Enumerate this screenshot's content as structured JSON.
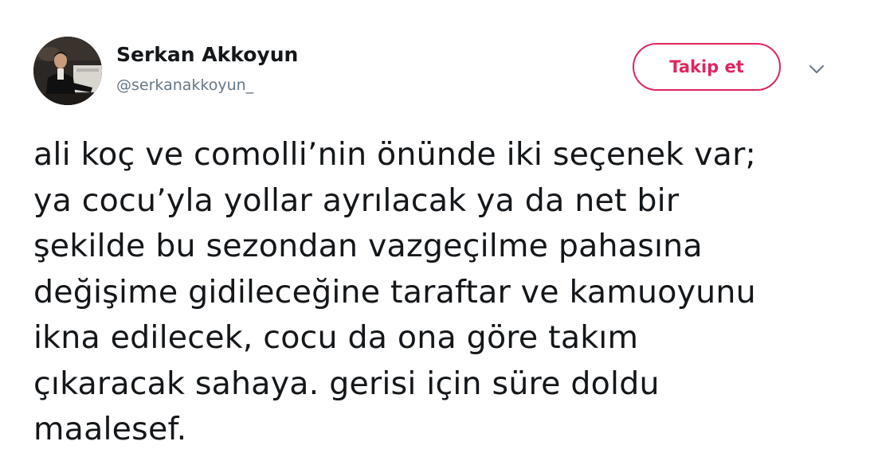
{
  "user": {
    "display_name": "Serkan Akkoyun",
    "handle": "@serkanakkoyun_"
  },
  "actions": {
    "follow_label": "Takip et",
    "more_icon": "chevron-down-icon"
  },
  "tweet": {
    "text": "ali koç ve comolli’nin önünde iki seçenek var;\nya cocu’yla yollar ayrılacak ya da net bir\nşekilde bu sezondan vazgeçilme pahasına\ndeğişime gidileceğine taraftar ve kamuoyunu\nikna edilecek, cocu da ona göre takım\nçıkaracak sahaya. gerisi için süre doldu\nmaalesef."
  },
  "colors": {
    "accent": "#e0245e",
    "text": "#14171a",
    "muted": "#657786"
  }
}
